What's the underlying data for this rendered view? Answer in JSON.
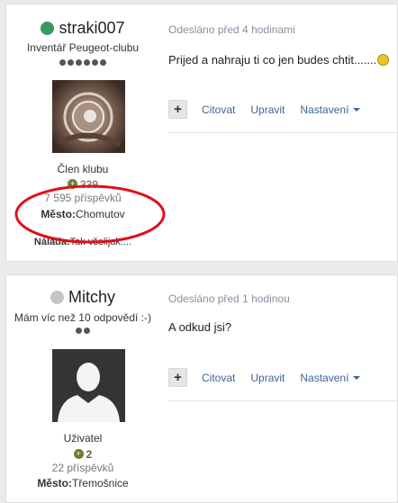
{
  "posts": [
    {
      "username": "straki007",
      "online_color": "#3a9a5b",
      "rank": "Inventář Peugeot-clubu",
      "pips": 6,
      "group": "Člen klubu",
      "reputation": "339",
      "post_count": "7 595 příspěvků",
      "location_label": "Město:",
      "location_value": "Chomutov",
      "mood_label": "Nálada:",
      "mood_value": "Tak všelijak....",
      "meta": "Odesláno před 4 hodinami",
      "text": "Prijed a nahraju ti co jen budes chtit.......",
      "emoji": "laughing-smiley-icon",
      "annotation_color": "#e0101a"
    },
    {
      "username": "Mitchy",
      "online_color": "#c4c4c4",
      "rank": "Mám víc než 10 odpovědí :-)",
      "pips": 2,
      "group": "Uživatel",
      "reputation": "2",
      "post_count": "22 příspěvků",
      "location_label": "Město:",
      "location_value": "Třemošnice",
      "meta": "Odesláno před 1 hodinou",
      "text": "A odkud jsi?"
    }
  ],
  "controls": {
    "plus": "+",
    "quote": "Citovat",
    "edit": "Upravit",
    "settings": "Nastavení"
  }
}
